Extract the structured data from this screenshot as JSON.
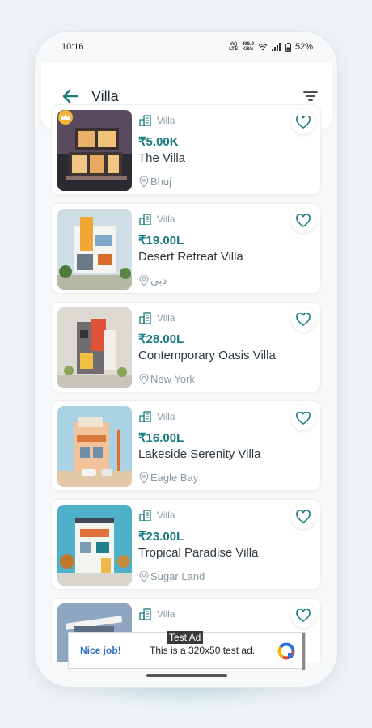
{
  "status": {
    "time": "10:16",
    "network_top": "406.9",
    "network_bottom": "KB/s",
    "volte_top": "Vo)",
    "volte_bottom": "LTE",
    "battery": "52%"
  },
  "header": {
    "title": "Villa"
  },
  "listings": [
    {
      "type": "Villa",
      "price": "₹5.00K",
      "name": "The Villa",
      "location": "Bhuj",
      "premium": true
    },
    {
      "type": "Villa",
      "price": "₹19.00L",
      "name": "Desert Retreat Villa",
      "location": "دبي"
    },
    {
      "type": "Villa",
      "price": "₹28.00L",
      "name": "Contemporary Oasis Villa",
      "location": "New York"
    },
    {
      "type": "Villa",
      "price": "₹16.00L",
      "name": "Lakeside Serenity Villa",
      "location": "Eagle Bay"
    },
    {
      "type": "Villa",
      "price": "₹23.00L",
      "name": "Tropical Paradise Villa",
      "location": "Sugar Land"
    },
    {
      "type": "Villa"
    }
  ],
  "ad": {
    "tag": "Test Ad",
    "headline": "Nice job!",
    "text": "This is a 320x50 test ad."
  },
  "colors": {
    "accent": "#177a80",
    "background": "#f6f8f9"
  }
}
